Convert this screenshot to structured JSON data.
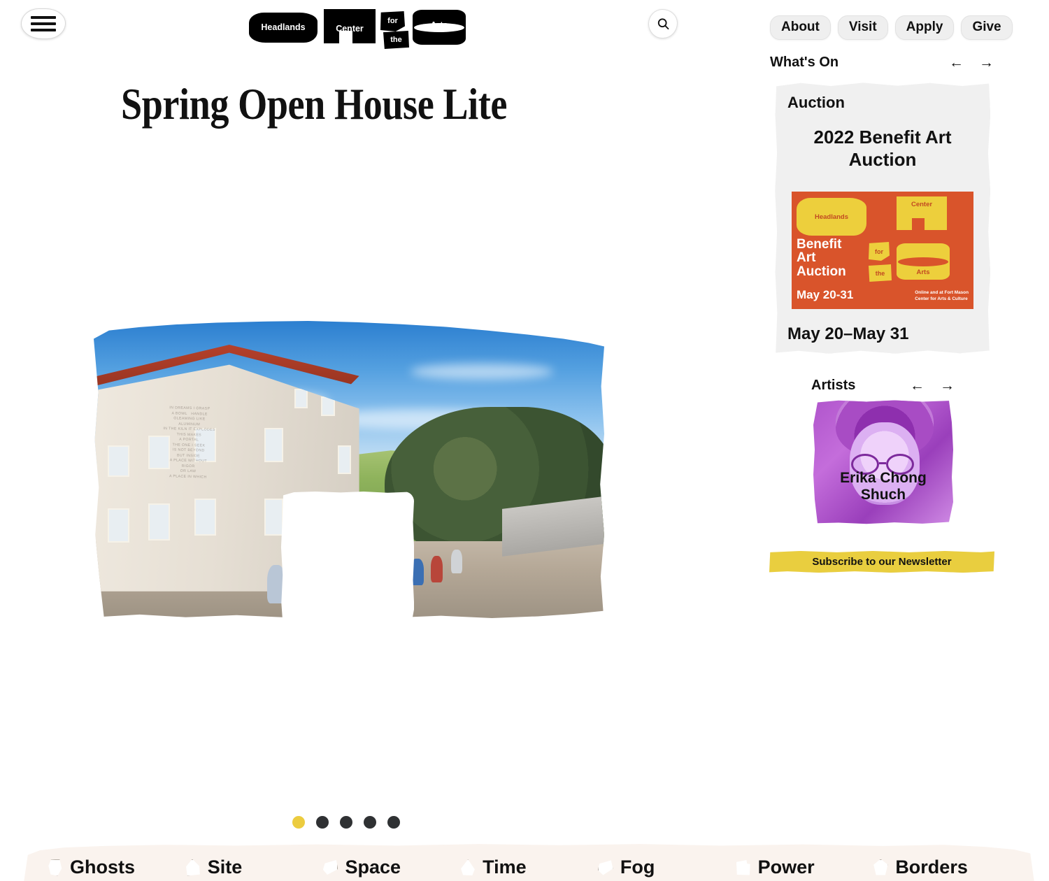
{
  "header": {
    "menu_icon": "hamburger-menu-icon",
    "search_icon": "search-icon",
    "logo": {
      "headlands": "Headlands",
      "center": "Center",
      "for": "for",
      "the": "the",
      "arts": "Arts"
    },
    "nav": [
      {
        "label": "About"
      },
      {
        "label": "Visit"
      },
      {
        "label": "Apply"
      },
      {
        "label": "Give"
      }
    ]
  },
  "main": {
    "title": "Spring Open House Lite",
    "hero_alt": "Rodeo Hall building with visitors gathered outdoors",
    "carousel": {
      "total": 5,
      "active_index": 0
    }
  },
  "whats_on": {
    "section_label": "What's On",
    "prev_arrow": "←",
    "next_arrow": "→",
    "card": {
      "kicker": "Auction",
      "title": "2022 Benefit Art Auction",
      "date": "May 20–May 31",
      "poster": {
        "headlands": "Headlands",
        "center": "Center",
        "for": "for",
        "the": "the",
        "arts": "Arts",
        "headline": "Benefit\nArt\nAuction",
        "headline_line1": "Benefit",
        "headline_line2": "Art",
        "headline_line3": "Auction",
        "dates": "May 20-31",
        "venue_line1": "Online and at Fort Mason",
        "venue_line2": "Center for Arts & Culture",
        "bg_color": "#d9542b",
        "accent_color": "#edcf3c"
      }
    }
  },
  "artists": {
    "section_label": "Artists",
    "prev_arrow": "←",
    "next_arrow": "→",
    "card": {
      "name_line1": "Erika Chong",
      "name_line2": "Shuch",
      "tint_color": "#b055cc"
    }
  },
  "newsletter": {
    "label": "Subscribe to our Newsletter",
    "color": "#e9ce3f"
  },
  "bottom_bar": {
    "background": "#faf3ee",
    "tabs": [
      {
        "label": "Ghosts",
        "icon": "blob-shape-icon"
      },
      {
        "label": "Site",
        "icon": "blob-shape-icon"
      },
      {
        "label": "Space",
        "icon": "blob-shape-icon"
      },
      {
        "label": "Time",
        "icon": "blob-shape-icon"
      },
      {
        "label": "Fog",
        "icon": "blob-shape-icon"
      },
      {
        "label": "Power",
        "icon": "blob-shape-icon"
      },
      {
        "label": "Borders",
        "icon": "blob-shape-icon"
      }
    ]
  },
  "colors": {
    "accent_yellow": "#e9ce3f",
    "dot_active": "#eccc3f",
    "dot_inactive": "#2f3133",
    "card_bg": "#f0f0f0"
  }
}
